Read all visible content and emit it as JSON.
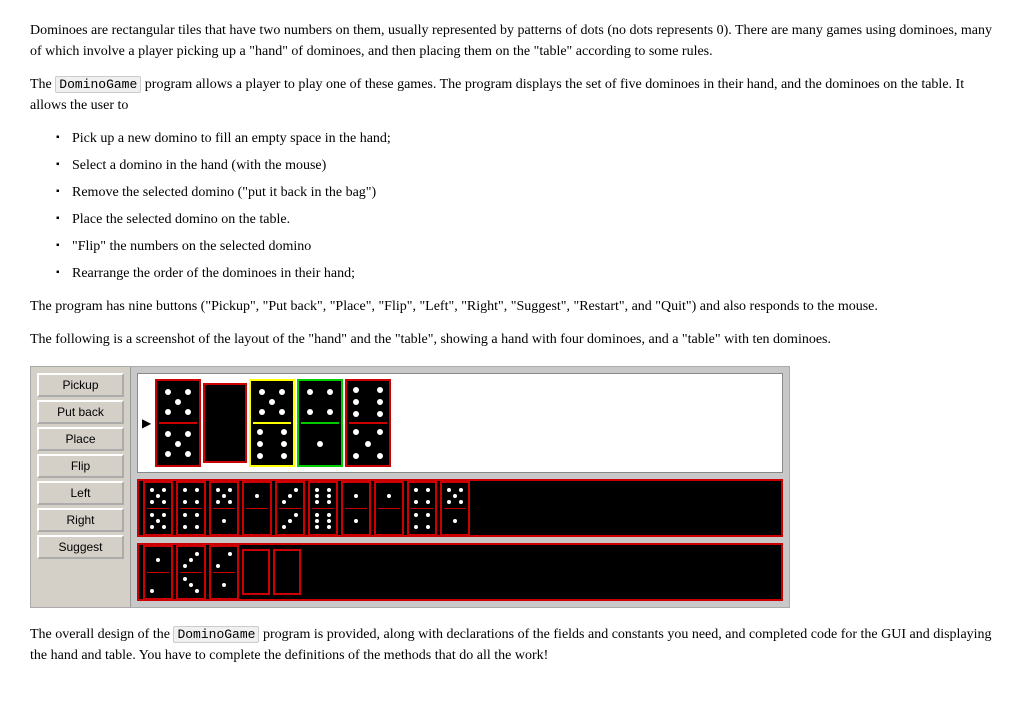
{
  "paragraphs": {
    "intro": "Dominoes are rectangular tiles that have two numbers on them, usually represented by patterns of dots (no dots represents 0). There are many games using dominoes, many of which involve a player picking up a \"hand\" of dominoes, and then placing them on the \"table\" according to some rules.",
    "program_intro": "The",
    "program_name": "DominoGame",
    "program_desc": "program allows a player to play one of these games. The program displays the set of five dominoes in their hand, and the dominoes on the table. It allows the user to",
    "bullets": [
      "Pick up a new domino to fill an empty space in the hand;",
      "Select a domino in the hand (with the mouse)",
      "Remove the selected domino (\"put it back in the bag\")",
      "Place the selected domino on the table.",
      "\"Flip\" the numbers on the selected domino",
      "Rearrange the order of the dominoes in their hand;"
    ],
    "buttons_desc": "The program has nine buttons (\"Pickup\", \"Put back\", \"Place\", \"Flip\", \"Left\", \"Right\", \"Suggest\", \"Restart\", and \"Quit\") and also responds to the mouse.",
    "screenshot_desc": "The following is a screenshot of the layout of the \"hand\" and the \"table\", showing a hand with four dominoes, and a \"table\" with ten dominoes.",
    "overall_desc1": "The overall design of the",
    "overall_program": "DominoGame",
    "overall_desc2": "program is provided, along with declarations of the fields and constants you need, and completed code for the GUI and displaying the hand and table. You have to complete the definitions of the methods that do all the work!"
  },
  "buttons": {
    "pickup": "Pickup",
    "putback": "Put back",
    "place": "Place",
    "flip": "Flip",
    "left": "Left",
    "right": "Right",
    "suggest": "Suggest"
  }
}
